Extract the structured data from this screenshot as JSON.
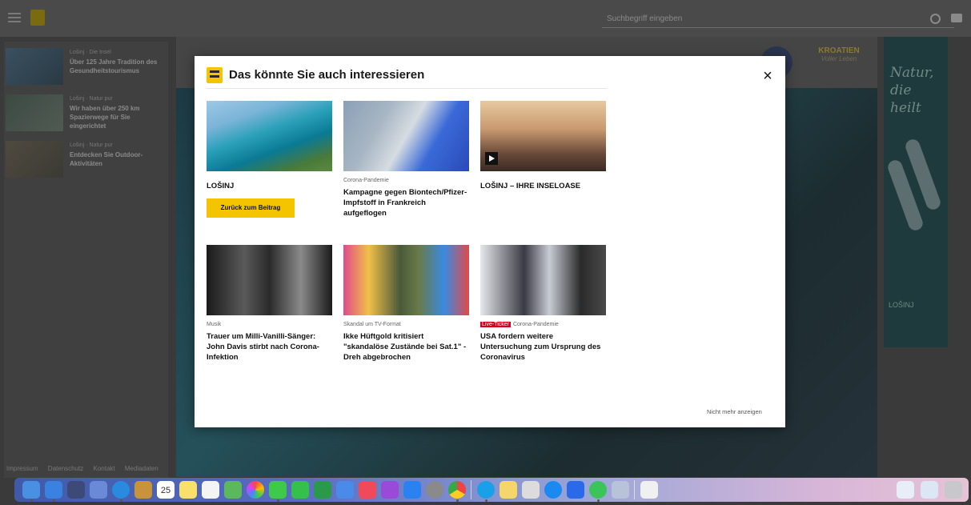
{
  "header": {
    "search_placeholder": "Suchbegriff eingeben"
  },
  "left_column": {
    "items": [
      {
        "kicker": "Lošinj · Die Insel",
        "title": "Über 125 Jahre Tradition des Gesundheitstourismus"
      },
      {
        "kicker": "Lošinj · Natur pur",
        "title": "Wir haben über 250 km Spazierwege für Sie eingerichtet"
      },
      {
        "kicker": "Lošinj · Natur pur",
        "title": "Entdecken Sie Outdoor-Aktivitäten"
      }
    ]
  },
  "ad": {
    "slogan": "Natur, die heilt",
    "brand": "KROATIEN",
    "brand_sub": "Voller Leben",
    "logo_text": "LOŠINJ"
  },
  "footer": {
    "links": [
      "Impressum",
      "Datenschutz",
      "Kontakt",
      "Mediadaten"
    ]
  },
  "modal": {
    "title": "Das könnte Sie auch interessieren",
    "close_label": "×",
    "cards": [
      {
        "title": "LOŠINJ",
        "button": "Zurück zum Beitrag"
      },
      {
        "category": "Corona-Pandemie",
        "title": "Kampagne gegen Biontech/Pfizer-Impfstoff in Frankreich aufgeflogen"
      },
      {
        "title": "LOŠINJ – IHRE INSELOASE"
      },
      {
        "category": "Musik",
        "title": "Trauer um Milli-Vanilli-Sänger: John Davis stirbt nach Corona-Infektion"
      },
      {
        "category": "Skandal um TV-Format",
        "title": "Ikke Hüftgold kritisiert \"skandalöse Zustände bei Sat.1\" - Dreh abgebrochen"
      },
      {
        "badge": "Live-Ticker",
        "category": "Corona-Pandemie",
        "title": "USA fordern weitere Untersuchung zum Ursprung des Coronavirus"
      }
    ],
    "no_more_label": "Nicht mehr anzeigen"
  },
  "dock": {
    "calendar_day": "25"
  },
  "colors": {
    "accent_yellow": "#f5c400",
    "live_red": "#d6001c"
  }
}
